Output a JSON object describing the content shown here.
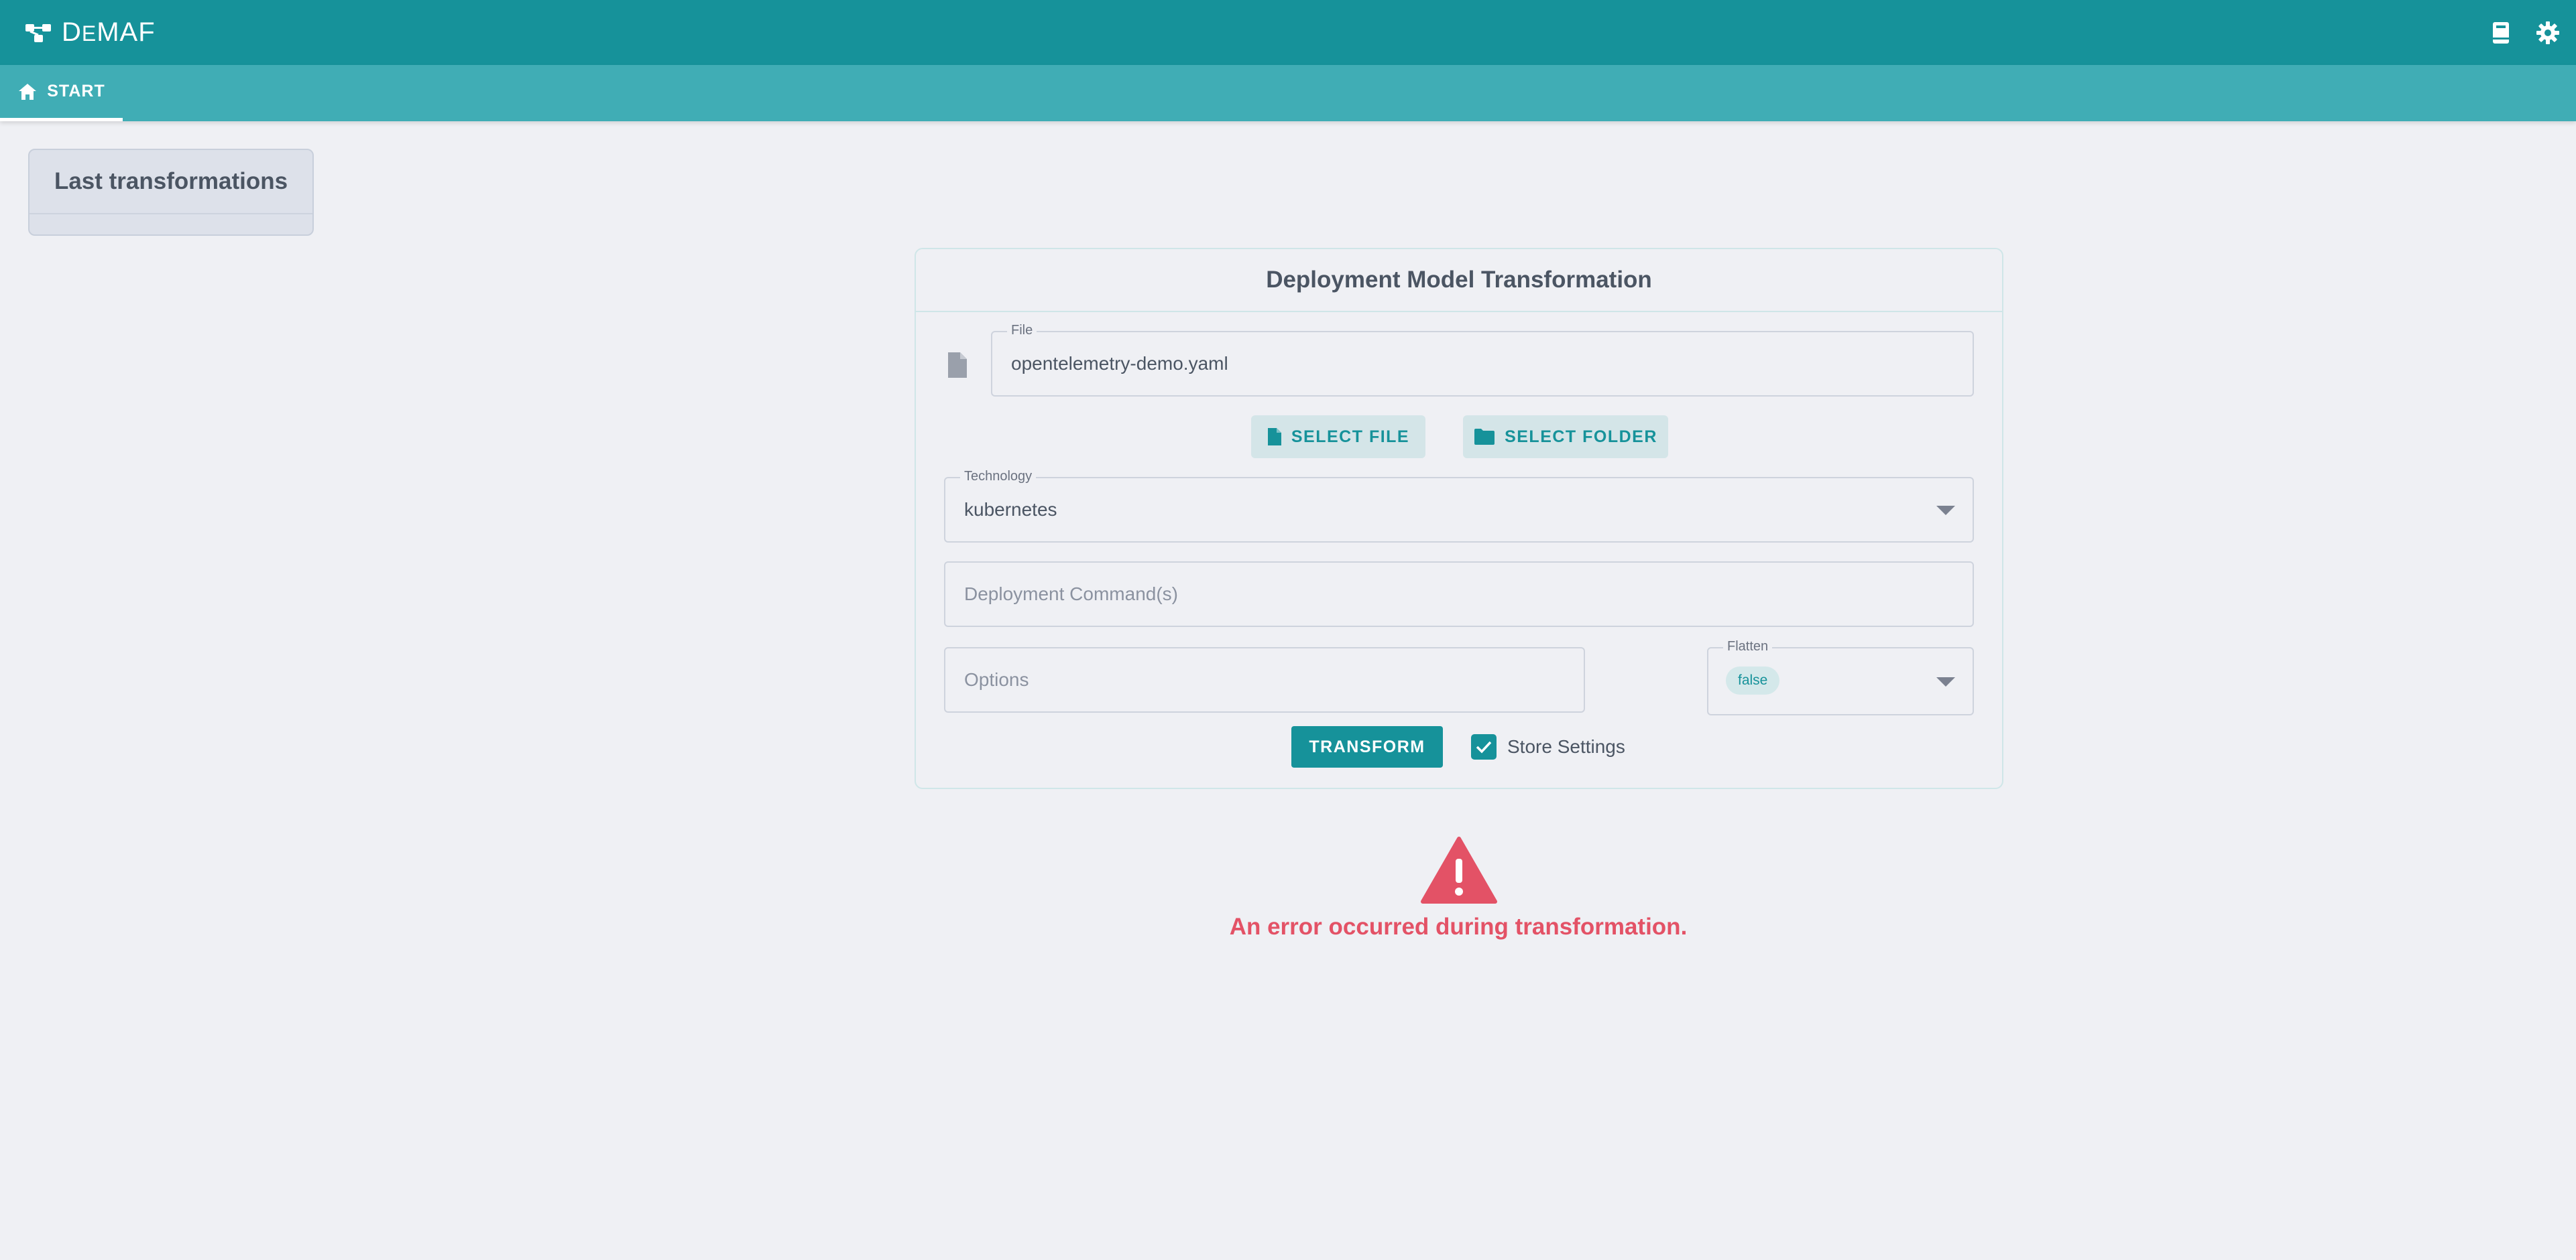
{
  "app": {
    "brand_prefix": "D",
    "brand_small": "E",
    "brand_suffix": "MAF"
  },
  "toolbar": {
    "icons": [
      "book-icon",
      "gear-icon"
    ]
  },
  "tabs": [
    {
      "label": "START",
      "icon": "home-icon",
      "active": true
    }
  ],
  "sidebar": {
    "last_transformations_label": "Last transformations"
  },
  "form": {
    "title": "Deployment Model Transformation",
    "file": {
      "legend": "File",
      "value": "opentelemetry-demo.yaml"
    },
    "select_file_label": "SELECT FILE",
    "select_folder_label": "SELECT FOLDER",
    "technology": {
      "legend": "Technology",
      "value": "kubernetes"
    },
    "deployment_commands": {
      "placeholder": "Deployment Command(s)"
    },
    "options": {
      "placeholder": "Options"
    },
    "flatten": {
      "legend": "Flatten",
      "value": "false"
    },
    "transform_label": "TRANSFORM",
    "store_settings": {
      "label": "Store Settings",
      "checked": true
    }
  },
  "error": {
    "message": "An error occurred during transformation."
  },
  "colors": {
    "primary": "#16929a",
    "tabbar": "#40adb5",
    "background": "#eff0f4",
    "error": "#e35266"
  }
}
